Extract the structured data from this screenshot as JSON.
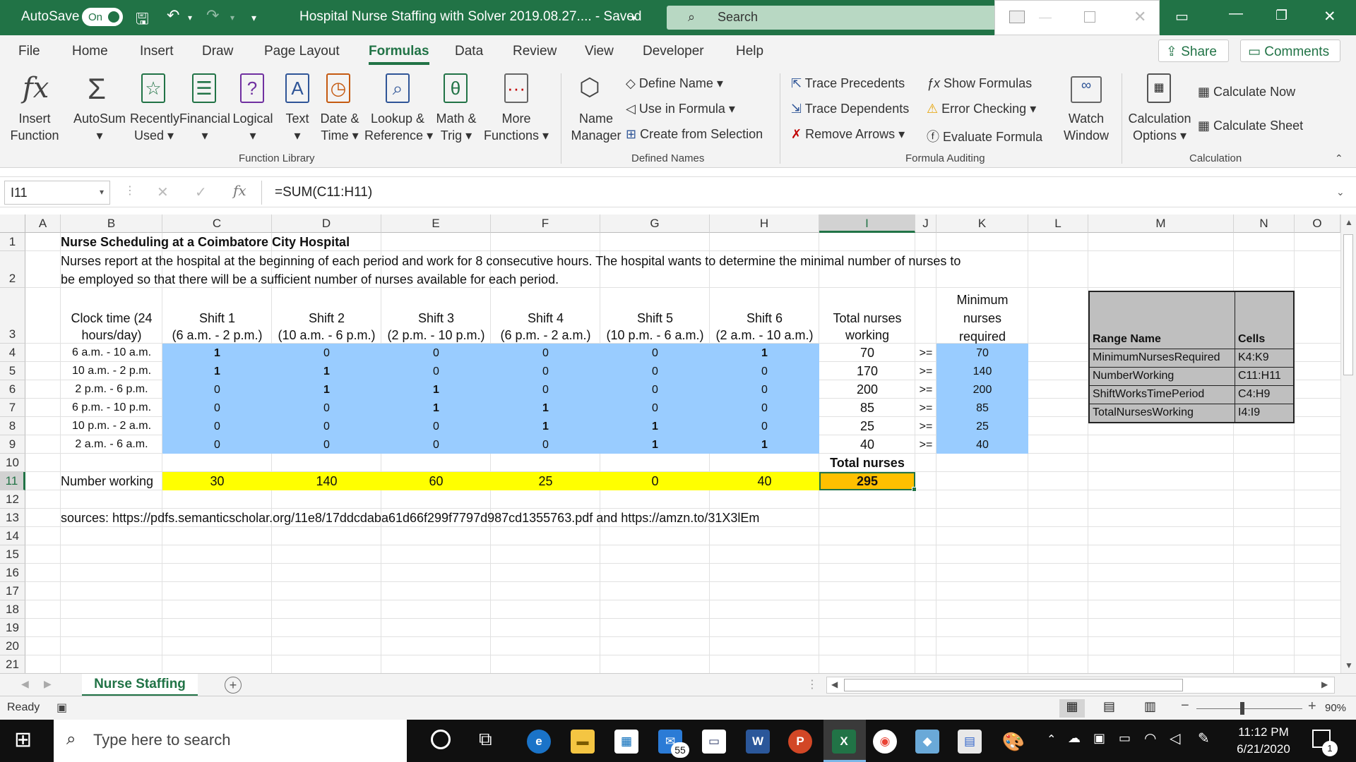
{
  "titlebar": {
    "autosave_label": "AutoSave",
    "autosave_state": "On",
    "title": "Hospital Nurse Staffing with Solver 2019.08.27....  -  Saved",
    "search_placeholder": "Search"
  },
  "ribbon_tabs": [
    "File",
    "Home",
    "Insert",
    "Draw",
    "Page Layout",
    "Formulas",
    "Data",
    "Review",
    "View",
    "Developer",
    "Help"
  ],
  "active_tab": "Formulas",
  "share_label": "Share",
  "comments_label": "Comments",
  "ribbon": {
    "function_library": {
      "label": "Function Library",
      "insert_function": [
        "Insert",
        "Function"
      ],
      "autosum": "AutoSum",
      "recently_used": [
        "Recently",
        "Used"
      ],
      "financial": "Financial",
      "logical": "Logical",
      "text": "Text",
      "date_time": [
        "Date &",
        "Time"
      ],
      "lookup_reference": [
        "Lookup &",
        "Reference"
      ],
      "math_trig": [
        "Math &",
        "Trig"
      ],
      "more_functions": [
        "More",
        "Functions"
      ]
    },
    "defined_names": {
      "label": "Defined Names",
      "name_manager": [
        "Name",
        "Manager"
      ],
      "define_name": "Define Name",
      "use_in_formula": "Use in Formula",
      "create_from_selection": "Create from Selection"
    },
    "formula_auditing": {
      "label": "Formula Auditing",
      "trace_precedents": "Trace Precedents",
      "trace_dependents": "Trace Dependents",
      "remove_arrows": "Remove Arrows",
      "show_formulas": "Show Formulas",
      "error_checking": "Error Checking",
      "evaluate_formula": "Evaluate Formula",
      "watch_window": [
        "Watch",
        "Window"
      ]
    },
    "calculation": {
      "label": "Calculation",
      "calculation_options": [
        "Calculation",
        "Options"
      ],
      "calculate_now": "Calculate Now",
      "calculate_sheet": "Calculate Sheet"
    }
  },
  "formula_bar": {
    "name_box": "I11",
    "formula": "=SUM(C11:H11)"
  },
  "columns": [
    "A",
    "B",
    "C",
    "D",
    "E",
    "F",
    "G",
    "H",
    "I",
    "J",
    "K",
    "L",
    "M",
    "N",
    "O"
  ],
  "selected_column": "I",
  "rows": [
    "1",
    "2",
    "3",
    "4",
    "5",
    "6",
    "7",
    "8",
    "9",
    "10",
    "11",
    "12",
    "13",
    "14",
    "15",
    "16",
    "17",
    "18",
    "19",
    "20",
    "21"
  ],
  "selected_row": "11",
  "sheet": {
    "title": "Nurse Scheduling at a Coimbatore City Hospital",
    "description_line1": "Nurses report at the hospital at the beginning of each period and work for 8 consecutive hours. The hospital wants to determine the minimal number of nurses to",
    "description_line2": "be employed so that there will be a sufficient number of nurses available for each period.",
    "clock_header": [
      "Clock time (24",
      "hours/day)"
    ],
    "shift_headers": [
      [
        "Shift 1",
        "(6 a.m. - 2 p.m.)"
      ],
      [
        "Shift 2",
        "(10 a.m. - 6 p.m.)"
      ],
      [
        "Shift 3",
        "(2 p.m. - 10 p.m.)"
      ],
      [
        "Shift 4",
        "(6 p.m. - 2 a.m.)"
      ],
      [
        "Shift 5",
        "(10 p.m. - 6 a.m.)"
      ],
      [
        "Shift 6",
        "(2 a.m. - 10 a.m.)"
      ]
    ],
    "total_header": [
      "Total nurses",
      "working"
    ],
    "min_header": [
      "Minimum",
      "nurses",
      "required"
    ],
    "periods": [
      {
        "time": "6 a.m. - 10 a.m.",
        "shifts": [
          "1",
          "0",
          "0",
          "0",
          "0",
          "1"
        ],
        "total": "70",
        "op": ">=",
        "min": "70"
      },
      {
        "time": "10 a.m. - 2 p.m.",
        "shifts": [
          "1",
          "1",
          "0",
          "0",
          "0",
          "0"
        ],
        "total": "170",
        "op": ">=",
        "min": "140"
      },
      {
        "time": "2 p.m. - 6 p.m.",
        "shifts": [
          "0",
          "1",
          "1",
          "0",
          "0",
          "0"
        ],
        "total": "200",
        "op": ">=",
        "min": "200"
      },
      {
        "time": "6 p.m. - 10 p.m.",
        "shifts": [
          "0",
          "0",
          "1",
          "1",
          "0",
          "0"
        ],
        "total": "85",
        "op": ">=",
        "min": "85"
      },
      {
        "time": "10 p.m. - 2 a.m.",
        "shifts": [
          "0",
          "0",
          "0",
          "1",
          "1",
          "0"
        ],
        "total": "25",
        "op": ">=",
        "min": "25"
      },
      {
        "time": "2 a.m. - 6 a.m.",
        "shifts": [
          "0",
          "0",
          "0",
          "0",
          "1",
          "1"
        ],
        "total": "40",
        "op": ">=",
        "min": "40"
      }
    ],
    "total_nurses_label": "Total nurses",
    "number_working_label": "Number working",
    "number_working": [
      "30",
      "140",
      "60",
      "25",
      "0",
      "40"
    ],
    "total_nurses": "295",
    "sources": "sources: https://pdfs.semanticscholar.org/11e8/17ddcdaba61d66f299f7797d987cd1355763.pdf and https://amzn.to/31X3lEm",
    "range_table": {
      "headers": [
        "Range Name",
        "Cells"
      ],
      "rows": [
        [
          "MinimumNursesRequired",
          "K4:K9"
        ],
        [
          "NumberWorking",
          "C11:H11"
        ],
        [
          "ShiftWorksTimePeriod",
          "C4:H9"
        ],
        [
          "TotalNursesWorking",
          "I4:I9"
        ]
      ]
    }
  },
  "sheet_tab": "Nurse Staffing",
  "status": {
    "ready": "Ready",
    "zoom": "90%"
  },
  "taskbar": {
    "search_placeholder": "Type here to search",
    "mail_badge": "55",
    "time": "11:12 PM",
    "date": "6/21/2020",
    "notification_count": "1"
  },
  "colors": {
    "excel_green": "#217346",
    "shift_fill": "#99ccff",
    "yellow": "#ffff00",
    "total_fill": "#ffc000",
    "range_fill": "#bfbfbf"
  }
}
